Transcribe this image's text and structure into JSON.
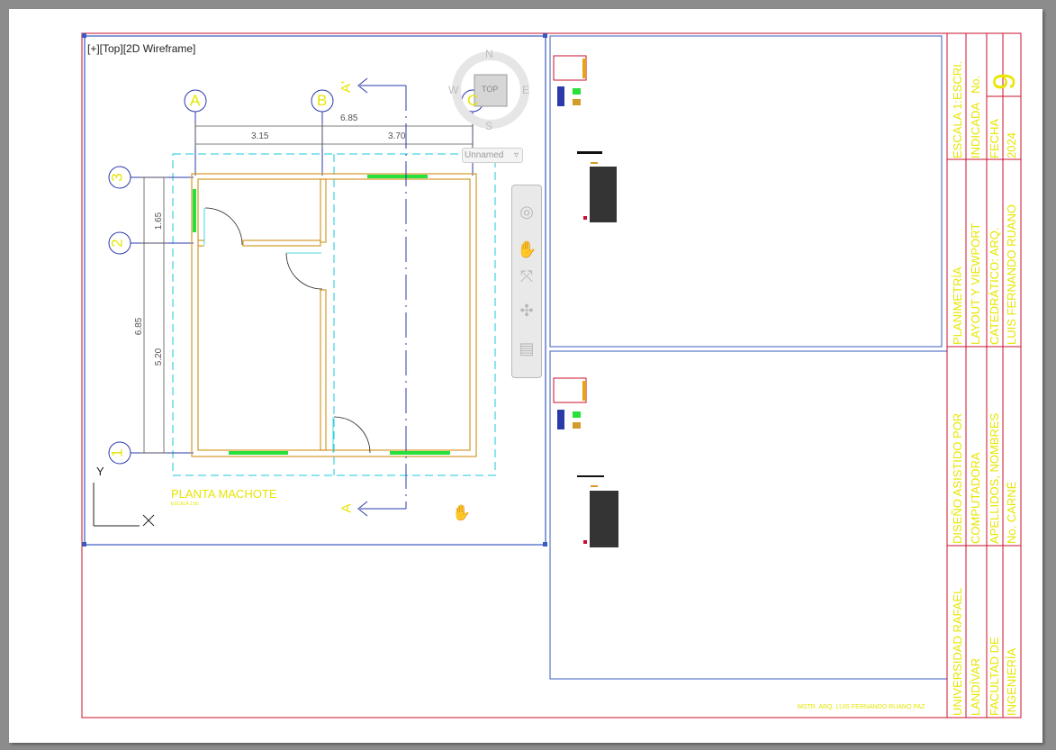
{
  "viewport": {
    "label": "[+][Top][2D Wireframe]"
  },
  "viewcube": {
    "top": "TOP",
    "north": "N",
    "south": "S",
    "east": "E",
    "west": "W"
  },
  "named_view": "Unnamed",
  "grid_labels": {
    "a": "A",
    "b": "B",
    "c": "C",
    "r1": "1",
    "r2": "2",
    "r3": "3"
  },
  "dimensions": {
    "total_width": "6.85",
    "span_ab": "3.15",
    "span_bc": "3.70",
    "total_height": "6.85",
    "upper": "1.65",
    "lower": "5.20"
  },
  "section_marks": {
    "top": "A'",
    "bottom": "A"
  },
  "drawing_title": "PLANTA MACHOTE",
  "drawing_scale": "ESCALA 1:50",
  "ucs": {
    "x": "X",
    "y": "Y"
  },
  "title_block": {
    "col1": [
      "ESCALA 1:ESCRI.",
      "No."
    ],
    "sheet_no": "9",
    "col2": [
      "INDICADA",
      "FECHA",
      "2024"
    ],
    "desc": [
      "PLANIMETRÍA",
      "LAYOUT Y VIEWPORT",
      "CATEDRÁTICO: ARQ.",
      "LUIS FERNANDO RUANO"
    ],
    "course": [
      "DISEÑO ASISTIDO POR",
      "COMPUTADORA",
      "APELLIDOS, NOMBRES",
      "No. CARNÉ"
    ],
    "univ": [
      "UNIVERSIDAD RAFAEL",
      "LANDÍVAR",
      "FACULTAD DE",
      "INGENIERÍA"
    ]
  },
  "credit": "MSTR. ARQ. LUIS FERNANDO RUANO PAZ",
  "colors": {
    "frame": "#c8102e",
    "viewport": "#3a5bbf",
    "yellow": "#e6e600",
    "wall": "#d49a2a",
    "cyan": "#19c9d9",
    "window": "#27e03a",
    "grid": "#2b3aa8"
  }
}
